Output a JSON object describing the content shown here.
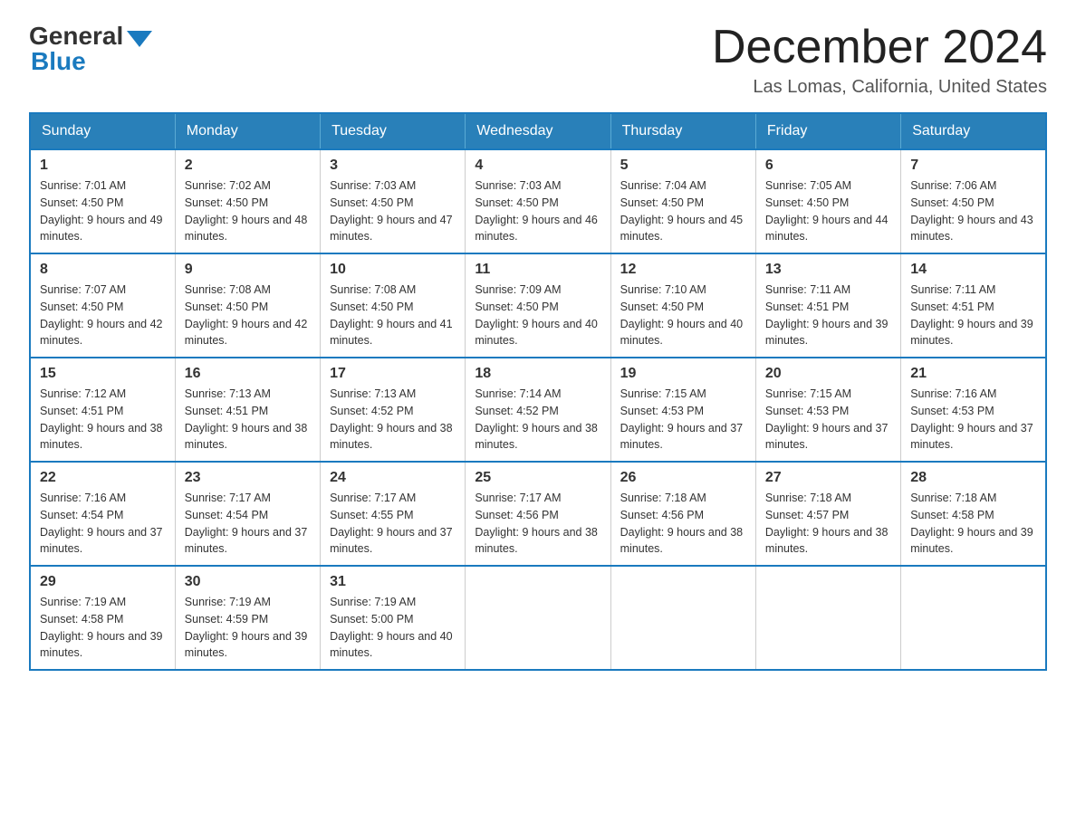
{
  "logo": {
    "general": "General",
    "blue": "Blue"
  },
  "header": {
    "month_year": "December 2024",
    "location": "Las Lomas, California, United States"
  },
  "days_of_week": [
    "Sunday",
    "Monday",
    "Tuesday",
    "Wednesday",
    "Thursday",
    "Friday",
    "Saturday"
  ],
  "weeks": [
    [
      {
        "day": "1",
        "sunrise": "7:01 AM",
        "sunset": "4:50 PM",
        "daylight": "9 hours and 49 minutes."
      },
      {
        "day": "2",
        "sunrise": "7:02 AM",
        "sunset": "4:50 PM",
        "daylight": "9 hours and 48 minutes."
      },
      {
        "day": "3",
        "sunrise": "7:03 AM",
        "sunset": "4:50 PM",
        "daylight": "9 hours and 47 minutes."
      },
      {
        "day": "4",
        "sunrise": "7:03 AM",
        "sunset": "4:50 PM",
        "daylight": "9 hours and 46 minutes."
      },
      {
        "day": "5",
        "sunrise": "7:04 AM",
        "sunset": "4:50 PM",
        "daylight": "9 hours and 45 minutes."
      },
      {
        "day": "6",
        "sunrise": "7:05 AM",
        "sunset": "4:50 PM",
        "daylight": "9 hours and 44 minutes."
      },
      {
        "day": "7",
        "sunrise": "7:06 AM",
        "sunset": "4:50 PM",
        "daylight": "9 hours and 43 minutes."
      }
    ],
    [
      {
        "day": "8",
        "sunrise": "7:07 AM",
        "sunset": "4:50 PM",
        "daylight": "9 hours and 42 minutes."
      },
      {
        "day": "9",
        "sunrise": "7:08 AM",
        "sunset": "4:50 PM",
        "daylight": "9 hours and 42 minutes."
      },
      {
        "day": "10",
        "sunrise": "7:08 AM",
        "sunset": "4:50 PM",
        "daylight": "9 hours and 41 minutes."
      },
      {
        "day": "11",
        "sunrise": "7:09 AM",
        "sunset": "4:50 PM",
        "daylight": "9 hours and 40 minutes."
      },
      {
        "day": "12",
        "sunrise": "7:10 AM",
        "sunset": "4:50 PM",
        "daylight": "9 hours and 40 minutes."
      },
      {
        "day": "13",
        "sunrise": "7:11 AM",
        "sunset": "4:51 PM",
        "daylight": "9 hours and 39 minutes."
      },
      {
        "day": "14",
        "sunrise": "7:11 AM",
        "sunset": "4:51 PM",
        "daylight": "9 hours and 39 minutes."
      }
    ],
    [
      {
        "day": "15",
        "sunrise": "7:12 AM",
        "sunset": "4:51 PM",
        "daylight": "9 hours and 38 minutes."
      },
      {
        "day": "16",
        "sunrise": "7:13 AM",
        "sunset": "4:51 PM",
        "daylight": "9 hours and 38 minutes."
      },
      {
        "day": "17",
        "sunrise": "7:13 AM",
        "sunset": "4:52 PM",
        "daylight": "9 hours and 38 minutes."
      },
      {
        "day": "18",
        "sunrise": "7:14 AM",
        "sunset": "4:52 PM",
        "daylight": "9 hours and 38 minutes."
      },
      {
        "day": "19",
        "sunrise": "7:15 AM",
        "sunset": "4:53 PM",
        "daylight": "9 hours and 37 minutes."
      },
      {
        "day": "20",
        "sunrise": "7:15 AM",
        "sunset": "4:53 PM",
        "daylight": "9 hours and 37 minutes."
      },
      {
        "day": "21",
        "sunrise": "7:16 AM",
        "sunset": "4:53 PM",
        "daylight": "9 hours and 37 minutes."
      }
    ],
    [
      {
        "day": "22",
        "sunrise": "7:16 AM",
        "sunset": "4:54 PM",
        "daylight": "9 hours and 37 minutes."
      },
      {
        "day": "23",
        "sunrise": "7:17 AM",
        "sunset": "4:54 PM",
        "daylight": "9 hours and 37 minutes."
      },
      {
        "day": "24",
        "sunrise": "7:17 AM",
        "sunset": "4:55 PM",
        "daylight": "9 hours and 37 minutes."
      },
      {
        "day": "25",
        "sunrise": "7:17 AM",
        "sunset": "4:56 PM",
        "daylight": "9 hours and 38 minutes."
      },
      {
        "day": "26",
        "sunrise": "7:18 AM",
        "sunset": "4:56 PM",
        "daylight": "9 hours and 38 minutes."
      },
      {
        "day": "27",
        "sunrise": "7:18 AM",
        "sunset": "4:57 PM",
        "daylight": "9 hours and 38 minutes."
      },
      {
        "day": "28",
        "sunrise": "7:18 AM",
        "sunset": "4:58 PM",
        "daylight": "9 hours and 39 minutes."
      }
    ],
    [
      {
        "day": "29",
        "sunrise": "7:19 AM",
        "sunset": "4:58 PM",
        "daylight": "9 hours and 39 minutes."
      },
      {
        "day": "30",
        "sunrise": "7:19 AM",
        "sunset": "4:59 PM",
        "daylight": "9 hours and 39 minutes."
      },
      {
        "day": "31",
        "sunrise": "7:19 AM",
        "sunset": "5:00 PM",
        "daylight": "9 hours and 40 minutes."
      },
      null,
      null,
      null,
      null
    ]
  ],
  "labels": {
    "sunrise_prefix": "Sunrise: ",
    "sunset_prefix": "Sunset: ",
    "daylight_prefix": "Daylight: "
  }
}
